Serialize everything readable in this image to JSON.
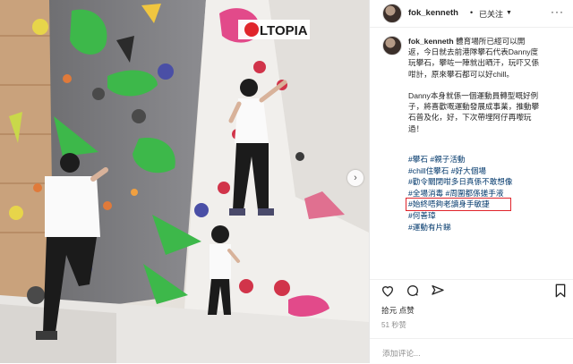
{
  "post": {
    "username": "fok_kenneth",
    "separator": "•",
    "follow_label": "已关注",
    "more_label": "···",
    "photo_sign": "LTOPIA",
    "caption_lines": [
      "體育場所已經可以開",
      "返，今日就去前港隊攀石代表Danny度",
      "玩攀石，攀咗一陣就出晒汗，玩吓又係",
      "咁計，原來攀石都可以好chill。",
      "",
      "Danny本身就係一個運動員轉型嘅好例",
      "子，將喜歡嘅運動發展成事業，推動攀",
      "石普及化，好，下次帶埋阿仔再嚟玩",
      "過！"
    ],
    "hashtags": [
      "#攀石 #親子活動",
      "#chill住攀石 #好大個場",
      "#勸令關閉咁多日真係不敢想像",
      "#全場消毒 #周圍都係搓手液",
      "#始終唔夠老讀身手敏捷",
      "#何善璋",
      "#運動有片睇"
    ],
    "highlight_color": "#e0242b",
    "likers_text": "拾元 点赞",
    "likes_count": "51 秒赞",
    "comment_placeholder": "添加评论..."
  },
  "icons": {
    "like": "heart-icon",
    "comment": "comment-icon",
    "share": "share-icon",
    "save": "bookmark-icon",
    "next": "chevron-right-icon"
  }
}
